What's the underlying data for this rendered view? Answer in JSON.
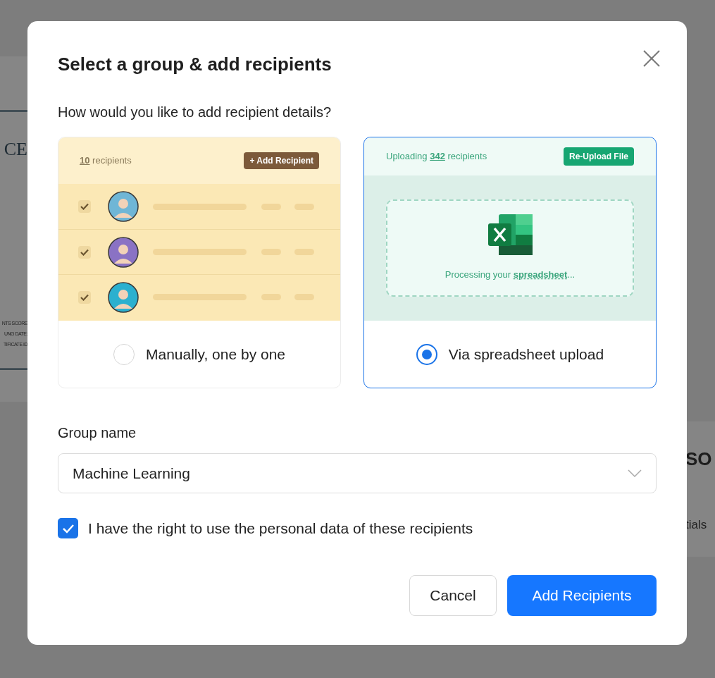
{
  "background": {
    "left_fragments": [
      {
        "kind": "heading",
        "text": "CE"
      },
      {
        "kind": "small",
        "text": "NTS SCORE"
      },
      {
        "kind": "small",
        "text": "UNG DATE:"
      },
      {
        "kind": "small",
        "text": "TIFICATE ID"
      }
    ],
    "right_fragments": [
      {
        "kind": "heading",
        "text": "SO"
      },
      {
        "kind": "body",
        "text": "tials"
      }
    ]
  },
  "dialog": {
    "title": "Select a group & add recipients",
    "question": "How would you like to add recipient details?",
    "options": [
      {
        "kind": "manual",
        "label": "Manually, one by one",
        "selected": false,
        "preview": {
          "count": "10",
          "count_suffix": "recipients",
          "button": "+ Add Recipient",
          "rows": [
            {
              "checked": true,
              "color": "#6fb6d6"
            },
            {
              "checked": true,
              "color": "#8a72c4"
            },
            {
              "checked": true,
              "color": "#2bb0cf"
            }
          ]
        }
      },
      {
        "kind": "spreadsheet",
        "label": "Via spreadsheet upload",
        "selected": true,
        "preview": {
          "prefix": "Uploading",
          "count": "342",
          "count_suffix": "recipients",
          "button": "Re-Upload File",
          "status_prefix": "Processing your",
          "status_word": "spreadsheet",
          "status_suffix": "..."
        }
      }
    ],
    "group": {
      "label": "Group name",
      "value": "Machine Learning"
    },
    "consent": {
      "label": "I have the right to use the personal data of these recipients",
      "checked": true
    },
    "buttons": [
      {
        "kind": "secondary",
        "label": "Cancel"
      },
      {
        "kind": "primary",
        "label": "Add Recipients"
      }
    ]
  }
}
